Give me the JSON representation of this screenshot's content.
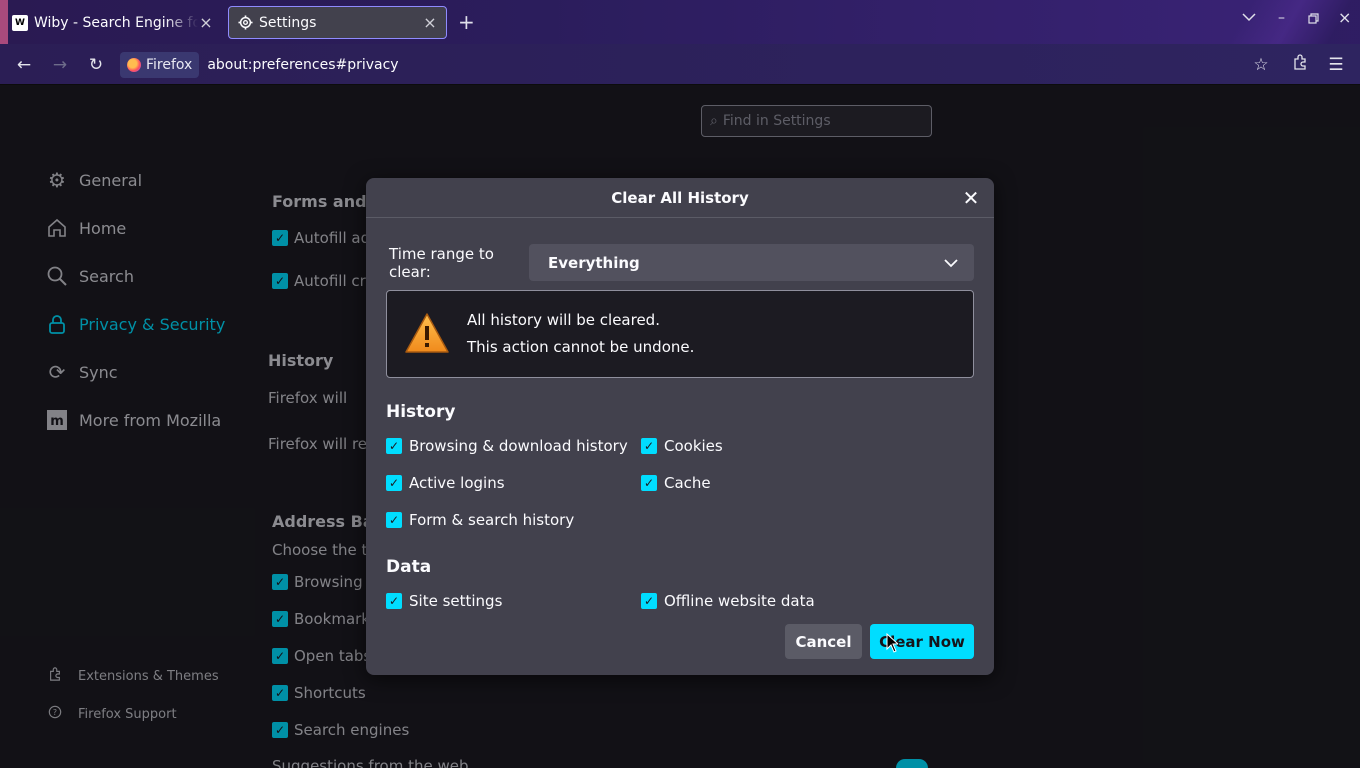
{
  "tabs": [
    {
      "label": "Wiby - Search Engine for the Classic Web",
      "favicon": "wiby-icon"
    },
    {
      "label": "Settings",
      "favicon": "gear-icon"
    }
  ],
  "navbar": {
    "identity_label": "Firefox",
    "url": "about:preferences#privacy"
  },
  "find": {
    "placeholder": "Find in Settings"
  },
  "sidebar": {
    "items": [
      {
        "label": "General",
        "icon": "gear-icon"
      },
      {
        "label": "Home",
        "icon": "home-icon"
      },
      {
        "label": "Search",
        "icon": "search-icon"
      },
      {
        "label": "Privacy & Security",
        "icon": "lock-icon",
        "active": true
      },
      {
        "label": "Sync",
        "icon": "sync-icon"
      },
      {
        "label": "More from Mozilla",
        "icon": "mozilla-icon"
      }
    ],
    "footer": [
      {
        "label": "Extensions & Themes",
        "icon": "puzzle-icon"
      },
      {
        "label": "Firefox Support",
        "icon": "help-icon"
      }
    ]
  },
  "background": {
    "forms_heading": "Forms and A",
    "autofill_addresses": "Autofill add",
    "autofill_cards": "Autofill cre",
    "history_heading": "History",
    "firefox_will": "Firefox will",
    "firefox_will_remember": "Firefox will rem",
    "address_bar_heading": "Address Bar",
    "choose_type": "Choose the typ",
    "browsing": "Browsing h",
    "bookmarks": "Bookmarks",
    "open_tabs": "Open tabs",
    "shortcuts": "Shortcuts",
    "search_engines": "Search engines",
    "suggestions": "Suggestions from the web"
  },
  "dialog": {
    "title": "Clear All History",
    "time_range_label": "Time range to clear:",
    "time_range_value": "Everything",
    "warning_line1": "All history will be cleared.",
    "warning_line2": "This action cannot be undone.",
    "history_heading": "History",
    "data_heading": "Data",
    "options": {
      "browsing_download": "Browsing & download history",
      "cookies": "Cookies",
      "active_logins": "Active logins",
      "cache": "Cache",
      "form_search": "Form & search history",
      "site_settings": "Site settings",
      "offline_data": "Offline website data"
    },
    "cancel_label": "Cancel",
    "clear_label": "Clear Now"
  },
  "colors": {
    "accent": "#00ddff",
    "dialog_bg": "#42414d",
    "page_bg": "#1c1b22"
  }
}
